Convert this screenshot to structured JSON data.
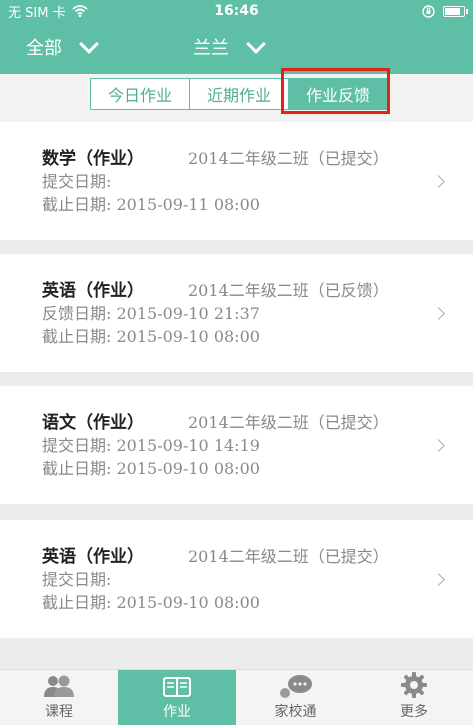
{
  "status_bar": {
    "carrier": "无 SIM 卡",
    "time": "16:46",
    "battery_level": 0.9
  },
  "nav": {
    "left_dropdown": "全部",
    "center_dropdown": "兰兰"
  },
  "segments": {
    "items": [
      "今日作业",
      "近期作业",
      "作业反馈"
    ],
    "active_index": 2
  },
  "cards": [
    {
      "subject": "数学（作业）",
      "class": "2014二年级二班（已提交）",
      "line1": "提交日期:",
      "line2": "截止日期: 2015-09-11 08:00"
    },
    {
      "subject": "英语（作业）",
      "class": "2014二年级二班（已反馈）",
      "line1": "反馈日期: 2015-09-10 21:37",
      "line2": "截止日期: 2015-09-10 08:00"
    },
    {
      "subject": "语文（作业）",
      "class": "2014二年级二班（已提交）",
      "line1": "提交日期: 2015-09-10 14:19",
      "line2": "截止日期: 2015-09-10 08:00"
    },
    {
      "subject": "英语（作业）",
      "class": "2014二年级二班（已提交）",
      "line1": "提交日期:",
      "line2": "截止日期: 2015-09-10 08:00"
    }
  ],
  "tabbar": {
    "items": [
      {
        "label": "课程",
        "icon": "people-icon"
      },
      {
        "label": "作业",
        "icon": "homework-book-icon"
      },
      {
        "label": "家校通",
        "icon": "chat-bubbles-icon"
      },
      {
        "label": "更多",
        "icon": "gear-icon"
      }
    ],
    "active_index": 1
  },
  "colors": {
    "theme": "#5fbfa6",
    "highlight_box": "#e2231a"
  }
}
